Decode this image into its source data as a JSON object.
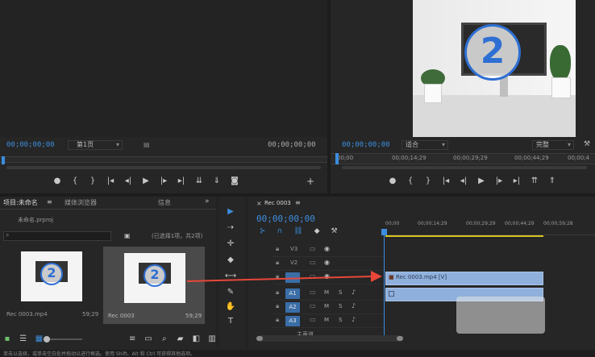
{
  "source_monitor": {
    "timecode_left": "00;00;00;00",
    "page_label": "第1页",
    "timecode_right": "00;00;00;00",
    "add_label": "+"
  },
  "program_monitor": {
    "timecode_left": "00;00;00;00",
    "fit_label": "适合",
    "quality_label": "完整",
    "ruler_ticks": [
      "00;00",
      "00;00;14;29",
      "00;00;29;29",
      "00;00;44;29",
      "00;00;4"
    ],
    "badge_number": "2"
  },
  "project_panel": {
    "tabs": [
      "项目:未命名",
      "媒体浏览器",
      "信息"
    ],
    "tab_more": "»",
    "project_file": "未命名.prproj",
    "search_placeholder": "",
    "selection_info": "(已选择1项，共2项)",
    "items": [
      {
        "name": "Rec 0003.mp4",
        "duration": "59;29",
        "badge": "2"
      },
      {
        "name": "Rec 0003",
        "duration": "59;29",
        "badge": "2"
      }
    ]
  },
  "tools": {
    "icons": [
      "selection-tool-icon",
      "track-select-tool-icon",
      "ripple-edit-tool-icon",
      "razor-tool-icon",
      "slip-tool-icon",
      "pen-tool-icon",
      "hand-tool-icon",
      "type-tool-icon"
    ],
    "glyphs": [
      "▶",
      "⇢",
      "✛",
      "◆",
      "⟷",
      "✎",
      "✋",
      "T"
    ]
  },
  "timeline": {
    "sequence_tab": "Rec 0003",
    "timecode": "00;00;00;00",
    "ruler_ticks": [
      "00;00",
      "00;00;14;29",
      "00;00;29;29",
      "00;00;44;29",
      "00;00;59;28"
    ],
    "video_tracks": [
      "V3",
      "V2",
      "V1"
    ],
    "audio_tracks": [
      "A1",
      "A2",
      "A3"
    ],
    "master_label": "主声道",
    "clip_label": "Rec 0003.mp4 [V]"
  },
  "status_bar": {
    "text": "单击以选择，或单击空白处并拖动以进行框选。使用 Shift、Alt 和 Ctrl 可获得其他选项。"
  },
  "colors": {
    "accent_blue": "#3c8dde",
    "clip_blue": "#8fb0dc",
    "arrow_red": "#e8473a",
    "work_area_yellow": "#d6c520"
  }
}
